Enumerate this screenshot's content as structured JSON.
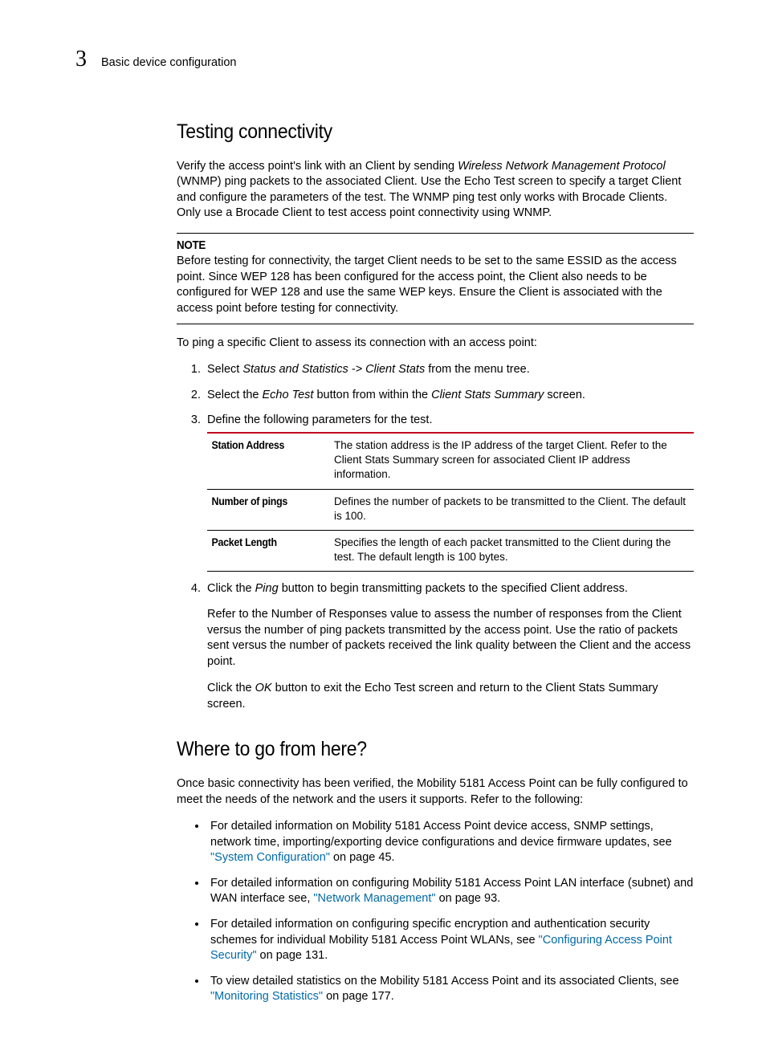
{
  "header": {
    "chapter_num": "3",
    "chapter_title": "Basic device configuration"
  },
  "section1": {
    "title": "Testing connectivity",
    "intro_before_em": "Verify the access point's link with an Client by sending ",
    "intro_em": "Wireless Network Management Protocol",
    "intro_after_em": " (WNMP) ping packets to the associated Client. Use the Echo Test screen to specify a target Client and configure the parameters of the test. The WNMP ping test only works with Brocade Clients. Only use a Brocade Client to test access point connectivity using WNMP.",
    "note_title": "NOTE",
    "note_body": "Before testing for connectivity, the target Client needs to be set to the same ESSID as the access point. Since WEP 128 has been configured for the access point, the Client also needs to be configured for WEP 128 and use the same WEP keys. Ensure the Client is associated with the access point before testing for connectivity.",
    "lead": "To ping a specific Client to assess its connection with an access point:",
    "step1_a": "Select ",
    "step1_em": "Status and Statistics -> Client Stats",
    "step1_b": " from the menu tree.",
    "step2_a": "Select the ",
    "step2_em1": "Echo Test",
    "step2_b": " button from within the ",
    "step2_em2": "Client Stats Summary",
    "step2_c": " screen.",
    "step3": "Define the following parameters for the test.",
    "table": {
      "rows": [
        {
          "name": "Station Address",
          "desc": "The station address is the IP address of the target Client. Refer to the Client Stats Summary screen for associated Client IP address information."
        },
        {
          "name": "Number of pings",
          "desc": "Defines the number of packets to be transmitted to the Client. The default is 100."
        },
        {
          "name": "Packet Length",
          "desc": "Specifies the length of each packet transmitted to the Client during the test. The default length is 100 bytes."
        }
      ]
    },
    "step4_a": "Click the ",
    "step4_em": "Ping",
    "step4_b": " button to begin transmitting packets to the specified Client address.",
    "step4_p2": "Refer to the Number of Responses value to assess the number of responses from the Client versus the number of ping packets transmitted by the access point. Use the ratio of packets sent versus the number of packets received the link quality between the Client and the access point.",
    "step4_p3_a": "Click the ",
    "step4_p3_em": "OK",
    "step4_p3_b": " button to exit the Echo Test screen and return to the Client Stats Summary screen."
  },
  "section2": {
    "title": "Where to go from here?",
    "intro": "Once basic connectivity has been verified, the Mobility 5181 Access Point can be fully configured to meet the needs of the network and the users it supports. Refer to the following:",
    "b1_a": "For detailed information on Mobility 5181 Access Point device access, SNMP settings, network time, importing/exporting device configurations and device firmware updates, see ",
    "b1_link": "\"System Configuration\"",
    "b1_b": " on page 45.",
    "b2_a": "For detailed information on configuring Mobility 5181 Access Point LAN interface (subnet) and WAN interface see, ",
    "b2_link": "\"Network Management\"",
    "b2_b": " on page 93.",
    "b3_a": "For detailed information on configuring specific encryption and authentication security schemes for individual Mobility 5181 Access Point WLANs, see ",
    "b3_link": "\"Configuring Access Point Security\"",
    "b3_b": " on page 131.",
    "b4_a": "To view detailed statistics on the Mobility 5181 Access Point and its associated Clients, see ",
    "b4_link": "\"Monitoring Statistics\"",
    "b4_b": " on page 177."
  }
}
